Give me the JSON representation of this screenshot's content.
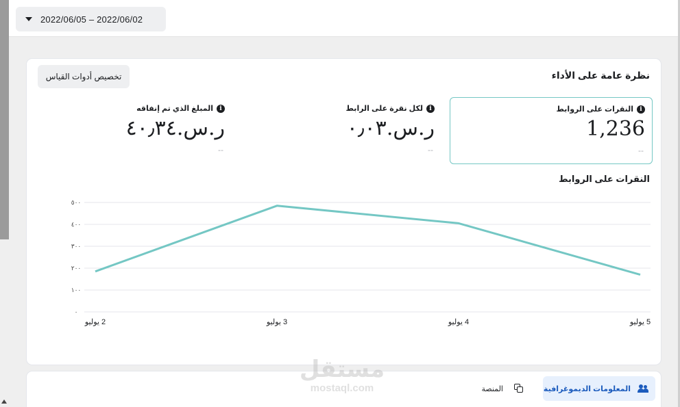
{
  "topbar": {
    "date_range": "2022/06/05 – 2022/06/02"
  },
  "overview": {
    "title": "نظرة عامة على الأداء",
    "customize_button": "تخصيص أدوات القياس",
    "metrics": [
      {
        "label": "النقرات على الروابط",
        "value": "1,236",
        "compare": "--",
        "selected": true
      },
      {
        "label": "لكل نقرة على الرابط",
        "value": "ر.س.٠٫٠٣",
        "compare": "--",
        "selected": false
      },
      {
        "label": "المبلغ الذي تم إنفاقه",
        "value": "ر.س.٤٠٫٣٤",
        "compare": "--",
        "selected": false
      }
    ],
    "info_icon_glyph": "i"
  },
  "chart_data": {
    "type": "line",
    "title": "النقرات على الروابط",
    "categories": [
      "2 يوليو",
      "3 يوليو",
      "4 يوليو",
      "5 يوليو"
    ],
    "values": [
      185,
      485,
      405,
      170
    ],
    "y_ticks": [
      "٠",
      "١٠٠",
      "٢٠٠",
      "٣٠٠",
      "٤٠٠",
      "٥٠٠"
    ],
    "ylim": [
      0,
      500
    ],
    "grid": true,
    "line_color": "#74c7c4"
  },
  "breakdown": {
    "tab_demographics": "المعلومات الديموغرافية",
    "tab_platform": "المنصة"
  },
  "watermark": {
    "arabic": "مستقل",
    "latin": "mostaql.com"
  },
  "colors": {
    "accent": "#74c7c4",
    "link_blue": "#1b5bbd",
    "button_bg": "#eeeff1"
  }
}
